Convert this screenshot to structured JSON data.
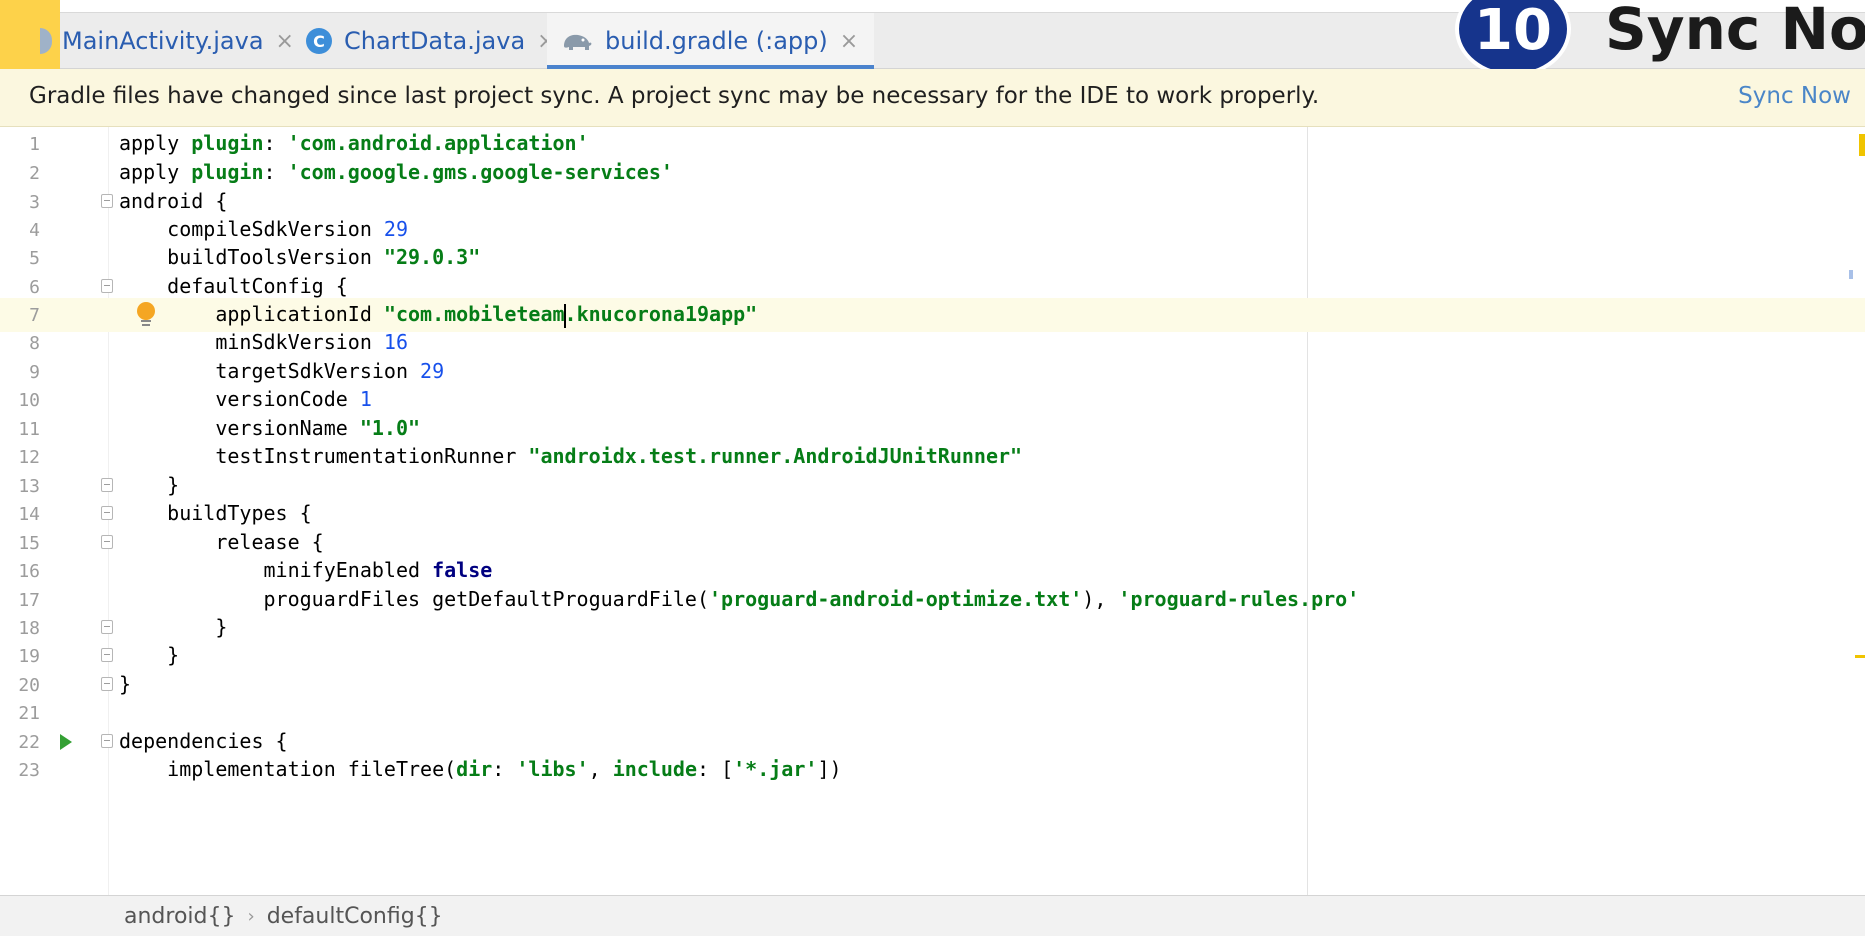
{
  "tabs": [
    {
      "label": "MainActivity.java",
      "icon": "java-class-icon",
      "close": "×"
    },
    {
      "label": "ChartData.java",
      "icon": "class-c-icon",
      "close": "×"
    },
    {
      "label": "build.gradle (:app)",
      "icon": "gradle-elephant-icon",
      "close": "×"
    }
  ],
  "class_icon_letter": "C",
  "step": {
    "number": "10",
    "text": "Sync Now"
  },
  "notification": {
    "message": "Gradle files have changed since last project sync. A project sync may be necessary for the IDE to work properly.",
    "action": "Sync Now"
  },
  "lines": [
    {
      "n": "1"
    },
    {
      "n": "2"
    },
    {
      "n": "3"
    },
    {
      "n": "4"
    },
    {
      "n": "5"
    },
    {
      "n": "6"
    },
    {
      "n": "7"
    },
    {
      "n": "8"
    },
    {
      "n": "9"
    },
    {
      "n": "10"
    },
    {
      "n": "11"
    },
    {
      "n": "12"
    },
    {
      "n": "13"
    },
    {
      "n": "14"
    },
    {
      "n": "15"
    },
    {
      "n": "16"
    },
    {
      "n": "17"
    },
    {
      "n": "18"
    },
    {
      "n": "19"
    },
    {
      "n": "20"
    },
    {
      "n": "21"
    },
    {
      "n": "22"
    },
    {
      "n": "23"
    }
  ],
  "code": {
    "l1": {
      "a": "apply ",
      "b": "plugin",
      "c": ": ",
      "d": "'com.android.application'"
    },
    "l2": {
      "a": "apply ",
      "b": "plugin",
      "c": ": ",
      "d": "'com.google.gms.google-services'"
    },
    "l3": {
      "a": "android {"
    },
    "l4": {
      "a": "    compileSdkVersion ",
      "b": "29"
    },
    "l5": {
      "a": "    buildToolsVersion ",
      "b": "\"29.0.3\""
    },
    "l6": {
      "a": "    defaultConfig {"
    },
    "l7": {
      "a": "        applicationId ",
      "b": "\"com.mobileteam",
      "c": ".knucorona19app\""
    },
    "l8": {
      "a": "        minSdkVersion ",
      "b": "16"
    },
    "l9": {
      "a": "        targetSdkVersion ",
      "b": "29"
    },
    "l10": {
      "a": "        versionCode ",
      "b": "1"
    },
    "l11": {
      "a": "        versionName ",
      "b": "\"1.0\""
    },
    "l12": {
      "a": "        testInstrumentationRunner ",
      "b": "\"androidx.test.runner.AndroidJUnitRunner\""
    },
    "l13": {
      "a": "    }"
    },
    "l14": {
      "a": "    buildTypes {"
    },
    "l15": {
      "a": "        release {"
    },
    "l16": {
      "a": "            minifyEnabled ",
      "b": "false"
    },
    "l17": {
      "a": "            proguardFiles getDefaultProguardFile(",
      "b": "'proguard-android-optimize.txt'",
      "c": "), ",
      "d": "'proguard-rules.pro'"
    },
    "l18": {
      "a": "        }"
    },
    "l19": {
      "a": "    }"
    },
    "l20": {
      "a": "}"
    },
    "l21": {
      "a": ""
    },
    "l22": {
      "a": "dependencies {"
    },
    "l23": {
      "a": "    implementation fileTree(",
      "b": "dir",
      "c": ": ",
      "d": "'libs'",
      "e": ", ",
      "f": "include",
      "g": ": [",
      "h": "'*.jar'",
      "i": "])"
    }
  },
  "breadcrumb": [
    "android{}",
    "defaultConfig{}"
  ],
  "breadcrumb_sep": "›",
  "colors": {
    "accent": "#4b83cd",
    "step_badge": "#16348c",
    "highlight": "#fdd24a"
  }
}
